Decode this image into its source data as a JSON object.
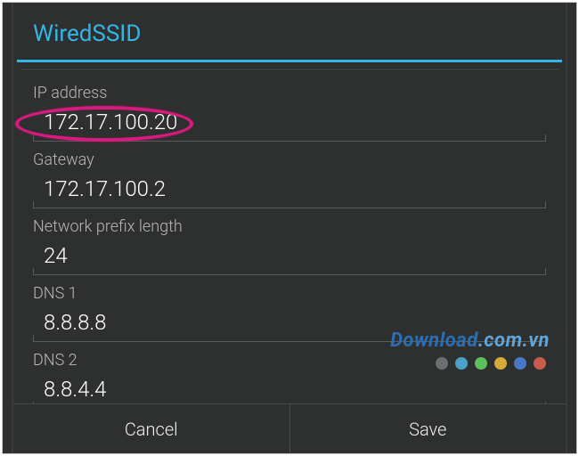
{
  "dialog": {
    "title": "WiredSSID"
  },
  "fields": {
    "ip_address": {
      "label": "IP address",
      "value": "172.17.100.20"
    },
    "gateway": {
      "label": "Gateway",
      "value": "172.17.100.2"
    },
    "prefix": {
      "label": "Network prefix length",
      "value": "24"
    },
    "dns1": {
      "label": "DNS 1",
      "value": "8.8.8.8"
    },
    "dns2": {
      "label": "DNS 2",
      "value": "8.8.4.4"
    }
  },
  "buttons": {
    "cancel": "Cancel",
    "save": "Save"
  },
  "watermark": {
    "text_main": "Download",
    "text_suffix": ".com.vn",
    "dot_colors": [
      "#6a6f73",
      "#4aa3c7",
      "#5bbf5b",
      "#d6a93a",
      "#4a78c7",
      "#c75b4a"
    ]
  }
}
